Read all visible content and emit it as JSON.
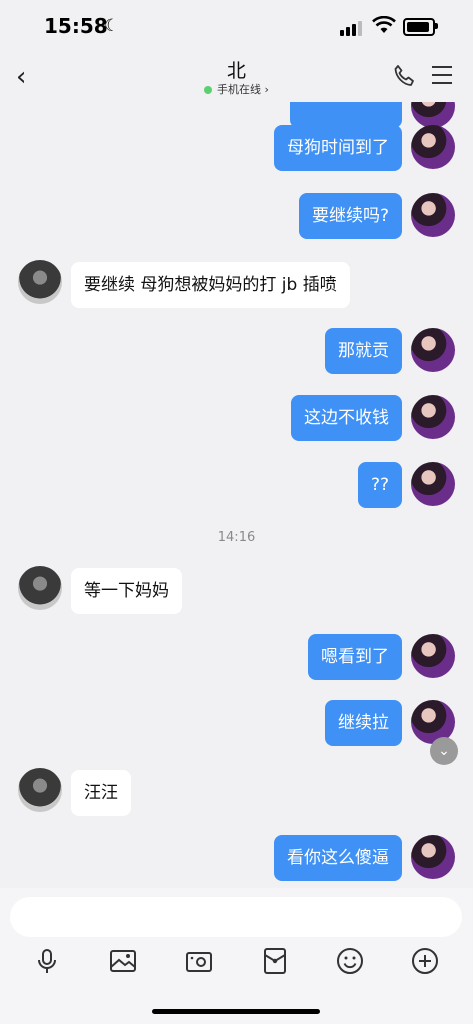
{
  "status": {
    "time": "15:58",
    "moon": "☾"
  },
  "header": {
    "back": "‹",
    "title": "北",
    "subtitle": "手机在线",
    "subtitle_chevron": "›",
    "online_color": "#5bd070"
  },
  "messages": [
    {
      "dir": "out",
      "text": "母狗时间到了"
    },
    {
      "dir": "out",
      "text": "要继续吗?"
    },
    {
      "dir": "in",
      "text": "要继续 母狗想被妈妈的打 jb 插喷"
    },
    {
      "dir": "out",
      "text": "那就贡"
    },
    {
      "dir": "out",
      "text": "这边不收钱"
    },
    {
      "dir": "out",
      "text": "??"
    },
    {
      "timestamp": "14:16"
    },
    {
      "dir": "in",
      "text": "等一下妈妈"
    },
    {
      "dir": "out",
      "text": "嗯看到了"
    },
    {
      "dir": "out",
      "text": "继续拉"
    },
    {
      "dir": "in",
      "text": "汪汪"
    },
    {
      "dir": "out",
      "text": "看你这么傻逼"
    }
  ],
  "colors": {
    "outgoing_bubble": "#3f91f5",
    "incoming_bubble": "#ffffff",
    "background": "#f1f1f3"
  },
  "input": {
    "placeholder": ""
  },
  "toolbar": [
    "microphone-icon",
    "image-icon",
    "camera-icon",
    "red-packet-icon",
    "emoji-icon",
    "plus-icon"
  ],
  "scroll_down_glyph": "⌄"
}
